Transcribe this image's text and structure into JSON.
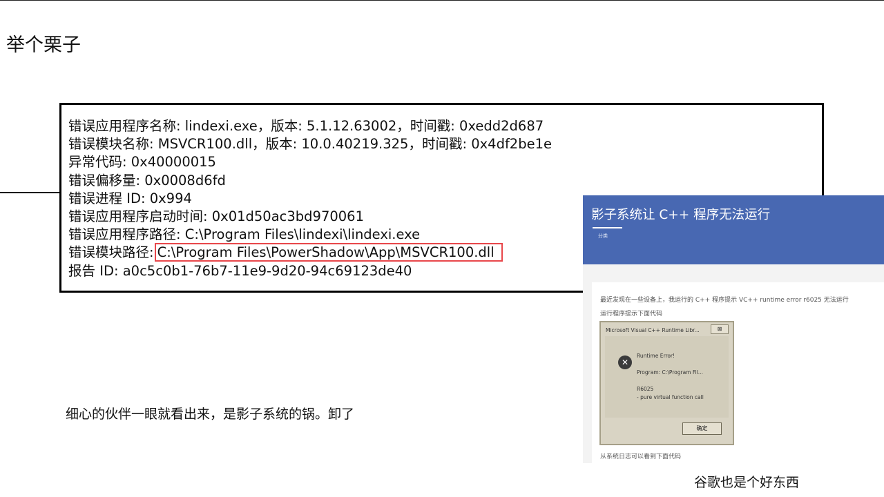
{
  "slide": {
    "title": "举个栗子",
    "error_log": [
      "错误应用程序名称: lindexi.exe，版本: 5.1.12.63002，时间戳: 0xedd2d687",
      "错误模块名称: MSVCR100.dll，版本: 10.0.40219.325，时间戳: 0x4df2be1e",
      "异常代码: 0x40000015",
      "错误偏移量: 0x0008d6fd",
      "错误进程 ID: 0x994",
      "错误应用程序启动时间: 0x01d50ac3bd970061",
      "错误应用程序路径: C:\\Program Files\\lindexi\\lindexi.exe",
      "报告 ID: a0c5c0b1-76b7-11e9-9d20-94c69123de40"
    ],
    "module_path_label": "错误模块路径:",
    "module_path_value": "C:\\Program Files\\PowerShadow\\App\\MSVCR100.dll",
    "highlight_color": "#e8474a",
    "note_left": "细心的伙伴一眼就看出来，是影子系统的锅。卸了",
    "note_right": "谷歌也是个好东西"
  },
  "article_screenshot": {
    "header_color": "#4868b2",
    "title": "影子系统让 C++ 程序无法运行",
    "category": "分类",
    "paragraph1": "最近发现在一些设备上，我运行的 C++ 程序提示 VC++ runtime error r6025 无法运行",
    "paragraph2": "运行程序提示下面代码",
    "footer_text": "从系统日志可以看到下面代码",
    "dialog": {
      "title": "Microsoft Visual C++ Runtime Libr...",
      "close": "⊠",
      "heading": "Runtime Error!",
      "program": "Program: C:\\Program Fil...",
      "code": "R6025",
      "message": "- pure virtual function call",
      "ok_button": "确定"
    }
  }
}
